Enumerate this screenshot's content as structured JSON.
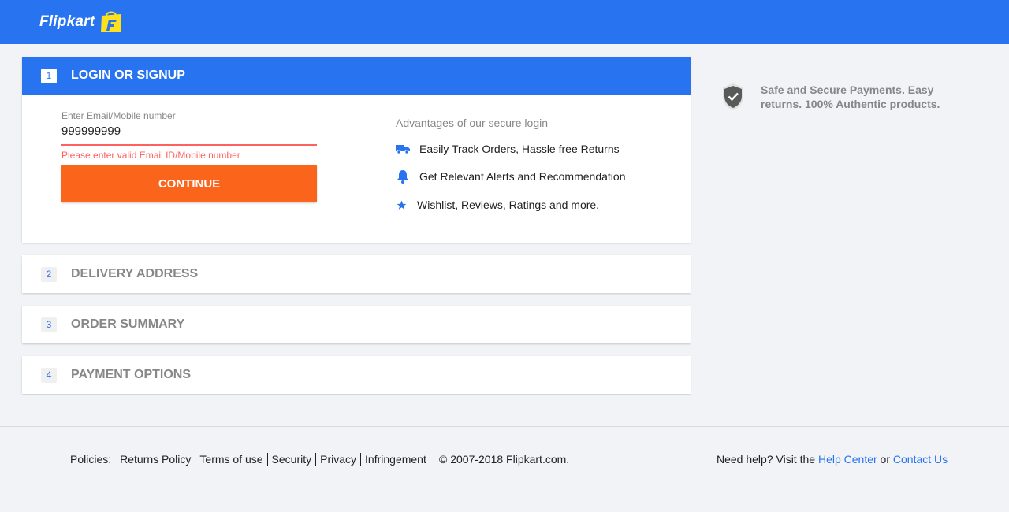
{
  "header": {
    "logo_text": "Flipkart",
    "brand_color": "#2874f0",
    "logo_bag_color": "#ffe11b"
  },
  "steps": [
    {
      "number": "1",
      "title": "LOGIN OR SIGNUP",
      "state": "active"
    },
    {
      "number": "2",
      "title": "DELIVERY ADDRESS",
      "state": "inactive"
    },
    {
      "number": "3",
      "title": "ORDER SUMMARY",
      "state": "inactive"
    },
    {
      "number": "4",
      "title": "PAYMENT OPTIONS",
      "state": "inactive"
    }
  ],
  "login": {
    "field_label": "Enter Email/Mobile number",
    "field_value": "999999999",
    "error_text": "Please enter valid Email ID/Mobile number",
    "error_color": "#ff6161",
    "continue_label": "CONTINUE",
    "continue_color": "#fb641b",
    "advantages_title": "Advantages of our secure login",
    "advantages": [
      {
        "icon": "truck-icon",
        "text": "Easily Track Orders, Hassle free Returns"
      },
      {
        "icon": "bell-icon",
        "text": "Get Relevant Alerts and Recommendation"
      },
      {
        "icon": "star-icon",
        "text": "Wishlist, Reviews, Ratings and more."
      }
    ]
  },
  "secure_note": {
    "icon": "shield-check-icon",
    "text": "Safe and Secure Payments. Easy returns. 100% Authentic products."
  },
  "footer": {
    "policies_label": "Policies:",
    "policy_links": [
      "Returns Policy",
      "Terms of use",
      "Security",
      "Privacy",
      "Infringement"
    ],
    "copyright": "© 2007-2018 Flipkart.com.",
    "help_prefix": "Need help? Visit the",
    "help_center": "Help Center",
    "help_or": "or",
    "contact_us": "Contact Us"
  }
}
